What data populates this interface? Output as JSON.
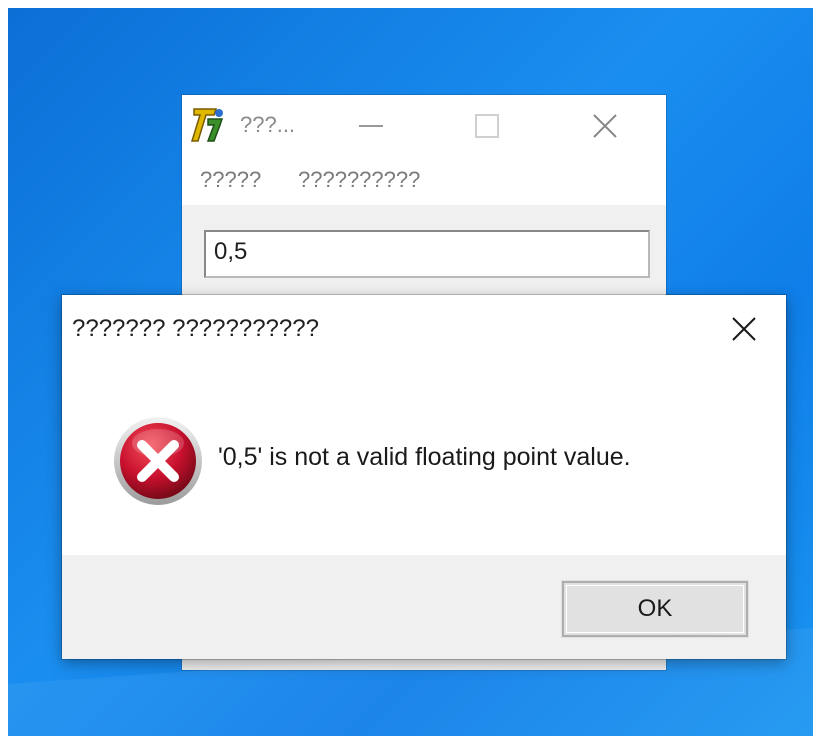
{
  "app_window": {
    "title": "???...",
    "menu": [
      {
        "label": "?????"
      },
      {
        "label": "??????????"
      }
    ],
    "input_value": "0,5"
  },
  "dialog": {
    "title": "??????? ???????????",
    "message": "'0,5' is not a valid floating point value.",
    "ok_label": "OK",
    "icon": "error-icon"
  },
  "colors": {
    "desktop_blue": "#0f7ee8",
    "error_red": "#c8102e",
    "dialog_footer": "#f0f0f0"
  }
}
